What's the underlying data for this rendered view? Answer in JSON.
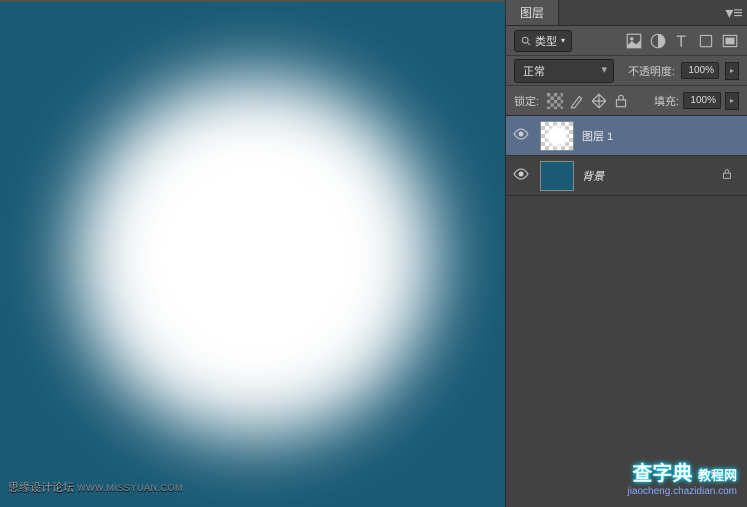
{
  "canvas": {
    "bg_color": "#1a5a75"
  },
  "watermarks": {
    "left_name": "思缘设计论坛",
    "left_url": "WWW.MISSYUAN.COM",
    "right_name": "查字典",
    "right_suffix": "教程网",
    "right_url": "jiaocheng.chazidian.com"
  },
  "panel": {
    "tab_label": "图层",
    "filter_label": "类型",
    "blend_mode": "正常",
    "opacity_label": "不透明度:",
    "opacity_value": "100%",
    "fill_label": "填充:",
    "fill_value": "100%",
    "lock_label": "锁定:",
    "layers": [
      {
        "name": "图层 1",
        "selected": true,
        "visible": true,
        "locked": false
      },
      {
        "name": "背景",
        "selected": false,
        "visible": true,
        "locked": true
      }
    ]
  }
}
